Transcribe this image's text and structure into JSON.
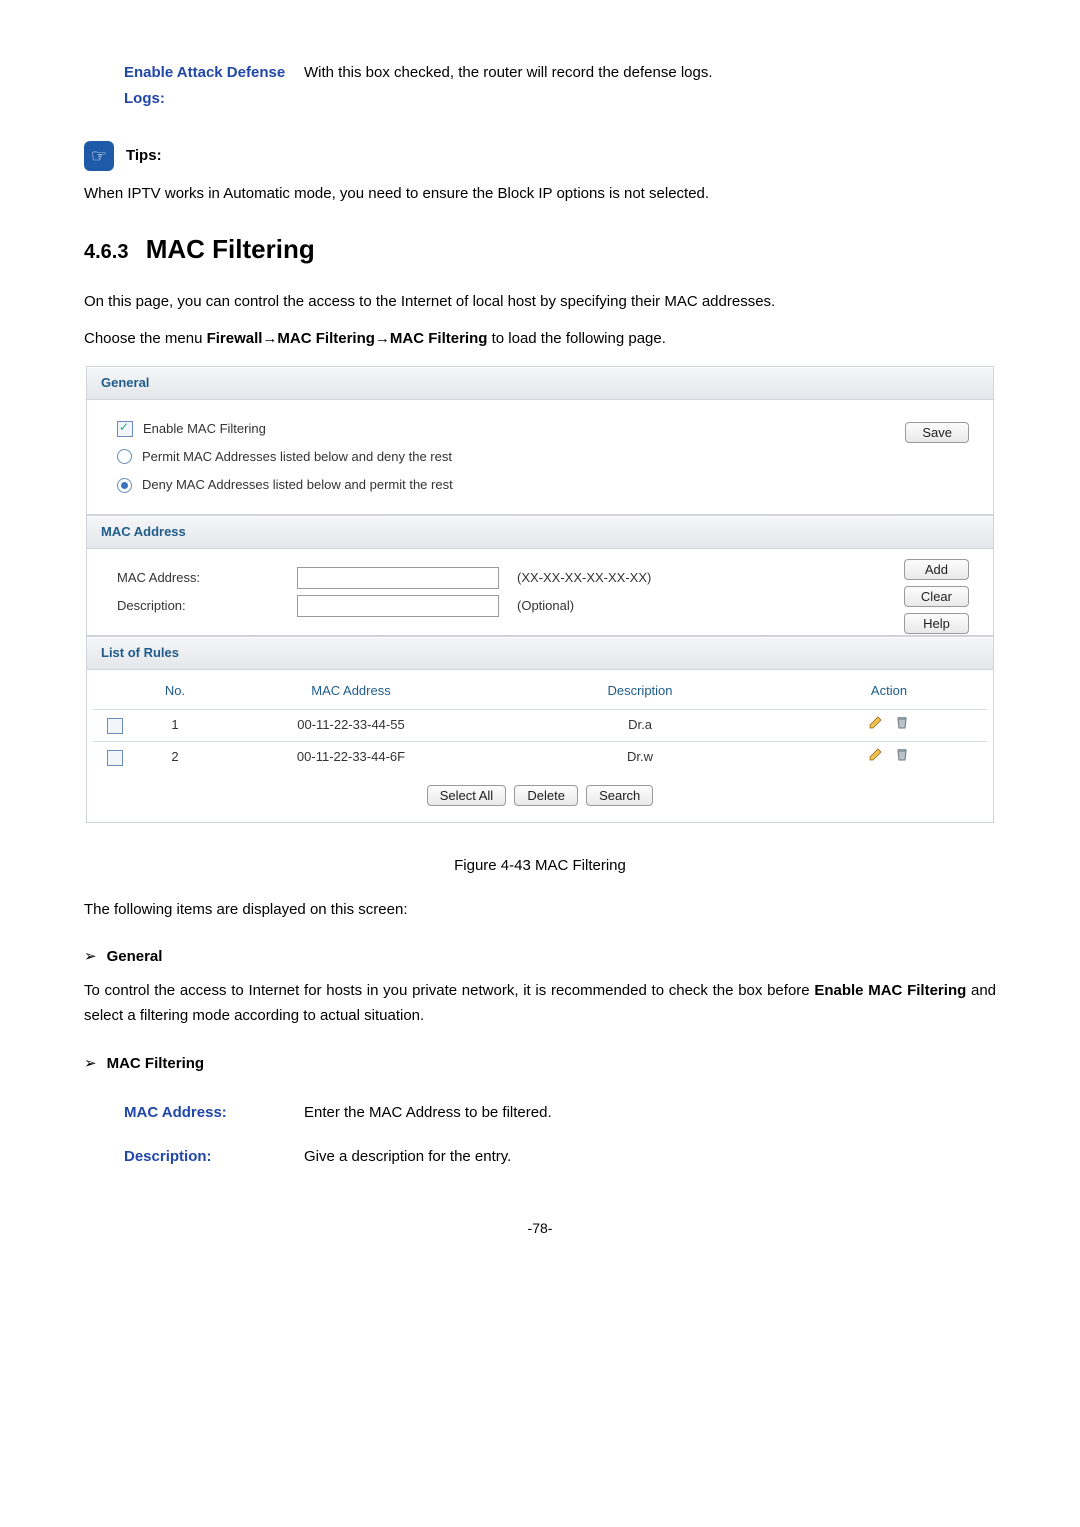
{
  "top_def": {
    "term": "Enable Attack Defense Logs:",
    "text": "With this box checked, the router will record the defense logs."
  },
  "tips": {
    "label": "Tips:",
    "text": "When IPTV works in Automatic mode, you need to ensure the Block IP options is not selected."
  },
  "heading": {
    "num": "4.6.3",
    "title": "MAC Filtering"
  },
  "intro": "On this page, you can control the access to the Internet of local host by specifying their MAC addresses.",
  "choose_pre": "Choose the menu ",
  "choose_bold": "Firewall→MAC Filtering→MAC Filtering",
  "choose_post": " to load the following page.",
  "ui": {
    "general_title": "General",
    "enable_label": "Enable MAC Filtering",
    "permit_label": "Permit MAC Addresses listed below and deny the rest",
    "deny_label": "Deny MAC Addresses listed below and permit the rest",
    "save": "Save",
    "mac_section_title": "MAC Address",
    "mac_label": "MAC Address:",
    "mac_hint": "(XX-XX-XX-XX-XX-XX)",
    "desc_label": "Description:",
    "desc_hint": "(Optional)",
    "add": "Add",
    "clear": "Clear",
    "help": "Help",
    "rules_title": "List of Rules",
    "cols": {
      "no": "No.",
      "mac": "MAC Address",
      "desc": "Description",
      "action": "Action"
    },
    "rows": [
      {
        "no": "1",
        "mac": "00-11-22-33-44-55",
        "desc": "Dr.a"
      },
      {
        "no": "2",
        "mac": "00-11-22-33-44-6F",
        "desc": "Dr.w"
      }
    ],
    "select_all": "Select All",
    "delete": "Delete",
    "search": "Search"
  },
  "caption": "Figure 4-43 MAC Filtering",
  "items_line": "The following items are displayed on this screen:",
  "sec_general": {
    "title": "General",
    "text_pre": "To control the access to Internet for hosts in you private network, it is recommended to check the box before ",
    "text_bold": "Enable MAC Filtering",
    "text_post": " and select a filtering mode according to actual situation."
  },
  "sec_mac": {
    "title": "MAC Filtering"
  },
  "field_mac": {
    "term": "MAC Address:",
    "text": "Enter the MAC Address to be filtered."
  },
  "field_desc": {
    "term": "Description:",
    "text": "Give a description for the entry."
  },
  "pagenum": "-78-"
}
